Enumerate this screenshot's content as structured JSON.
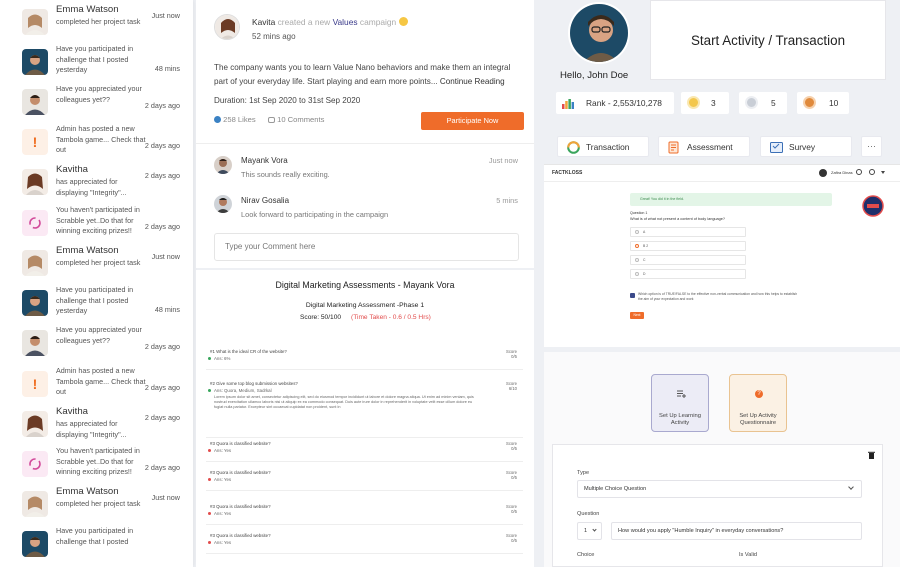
{
  "notifications": [
    {
      "name": "Emma Watson",
      "text": "completed her project task",
      "time": "Just now",
      "type": "woman"
    },
    {
      "name": "",
      "text": "Have you participated in challenge that I posted yesterday",
      "time": "48 mins",
      "type": "man"
    },
    {
      "name": "",
      "text": "Have you appreciated your colleagues yet??",
      "time": "2 days ago",
      "type": "man2"
    },
    {
      "name": "",
      "text": "Admin has posted a new Tambola game... Check that out",
      "time": "2 days ago",
      "type": "alert"
    },
    {
      "name": "Kavitha",
      "text": "has appreciated for displaying \"Integrity\"...",
      "time": "2 days ago",
      "type": "woman2"
    },
    {
      "name": "",
      "text": "You haven't participated in Scrabble yet..Do that for winning exciting prizes!!",
      "time": "2 days ago",
      "type": "cycle"
    },
    {
      "name": "Emma Watson",
      "text": "completed her project task",
      "time": "Just now",
      "type": "woman"
    },
    {
      "name": "",
      "text": "Have you participated in challenge that I posted yesterday",
      "time": "48 mins",
      "type": "man"
    },
    {
      "name": "",
      "text": "Have you appreciated your colleagues yet??",
      "time": "2 days ago",
      "type": "man2"
    },
    {
      "name": "",
      "text": "Admin has posted a new Tambola game... Check that out",
      "time": "2 days ago",
      "type": "alert"
    },
    {
      "name": "Kavitha",
      "text": "has appreciated for displaying \"Integrity\"...",
      "time": "2 days ago",
      "type": "woman2"
    },
    {
      "name": "",
      "text": "You haven't participated in Scrabble yet..Do that for winning exciting prizes!!",
      "time": "2 days ago",
      "type": "cycle"
    },
    {
      "name": "Emma Watson",
      "text": "completed her project task",
      "time": "Just now",
      "type": "woman"
    },
    {
      "name": "",
      "text": "Have you participated in challenge that I posted",
      "time": "",
      "type": "man"
    }
  ],
  "post": {
    "author": "Kavita",
    "action_pre": "created a new",
    "campaign": "Values",
    "action_post": "campaign",
    "time": "52 mins ago",
    "body": "The company wants you to learn Value Nano behaviors and make them an integral part of your everyday life. Start playing and earn more points...",
    "continue": "Continue Reading",
    "duration": "Duration: 1st Sep 2020 to 31st Sep 2020",
    "likes": "258 Likes",
    "comments_count": "10 Comments",
    "participate": "Participate Now",
    "comments": [
      {
        "name": "Mayank Vora",
        "text": "This sounds really exciting.",
        "time": "Just now"
      },
      {
        "name": "Nirav Gosalia",
        "text": "Look forward to participating in the campaign",
        "time": "5 mins"
      }
    ],
    "comment_placeholder": "Type your Comment here"
  },
  "assessment": {
    "title": "Digital Marketing Assessments - Mayank Vora",
    "subtitle": "Digital Marketing Assessment -Phase 1",
    "score": "Score: 50/100",
    "time_taken": "(Time Taken - 0.6 / 0.5 Hrs)",
    "questions": [
      {
        "q": "#1 What is the ideal CR of the website?",
        "a": "Ans: 6%",
        "score_label": "Score",
        "score": "0/5",
        "red": false
      },
      {
        "q": "#2 Give some top blog submission websites?",
        "a": "Ans: Quora, Medium, Sadrkal",
        "score_label": "Score",
        "score": "6/10",
        "red": false,
        "extra": "Lorem ipsum dolor sit amet, consectetur adipiscing elit, sed do eiusmod tempor incididunt ut labore et dolore magna aliqua. Ut enim ad minim veniam, quis nostrud exercitation ullamco laboris nisi ut aliquip ex ea commodo consequat. Duis aute irure dolor in reprehenderit in voluptate velit esse cillum dolore eu fugiat nulla pariatur. Excepteur sint occaecat cupidatat non proident, sunt in"
      },
      {
        "q": "#3 Quora is classified website?",
        "a": "Ans: Yes",
        "score_label": "Score",
        "score": "0/5",
        "red": true
      },
      {
        "q": "#3 Quora is classified website?",
        "a": "Ans: Yes",
        "score_label": "Score",
        "score": "0/5",
        "red": true
      },
      {
        "q": "#3 Quora is classified website?",
        "a": "Ans: Yes",
        "score_label": "Score",
        "score": "0/5",
        "red": true
      },
      {
        "q": "#3 Quora is classified website?",
        "a": "Ans: Yes",
        "score_label": "Score",
        "score": "0/5",
        "red": true
      }
    ]
  },
  "profile": {
    "greeting": "Hello, John Doe"
  },
  "start_activity": "Start Activity / Transaction",
  "stats": {
    "rank": "Rank - 2,553/10,278",
    "gold": "3",
    "silver": "5",
    "bronze": "10"
  },
  "tabs": {
    "transaction": "Transaction",
    "assessment": "Assessment",
    "survey": "Survey",
    "more": "···"
  },
  "screenshot": {
    "logo": "FACTKLOSS",
    "user": "Zafira Dinas",
    "banner": "Great! You did it in the field.",
    "question_no": "Question 1",
    "question": "What is of what not present a content of body language?",
    "options": [
      "A",
      "B 2",
      "C",
      "D"
    ],
    "note": "Which option is of TRUE/FALSE to the effective non-verbal communication and how this helps to establish the aim of your expectation and work",
    "btn": "Next"
  },
  "setup": {
    "card1": "Set Up Learning Activity",
    "card2": "Set Up Activity Questionnaire",
    "type_label": "Type",
    "type_value": "Multiple Choice Question",
    "question_label": "Question",
    "question_no": "1",
    "question_value": "How would you apply \"Humble Inquiry\" in everyday conversations?",
    "choice_label": "Choice",
    "valid_label": "Is Valid"
  }
}
